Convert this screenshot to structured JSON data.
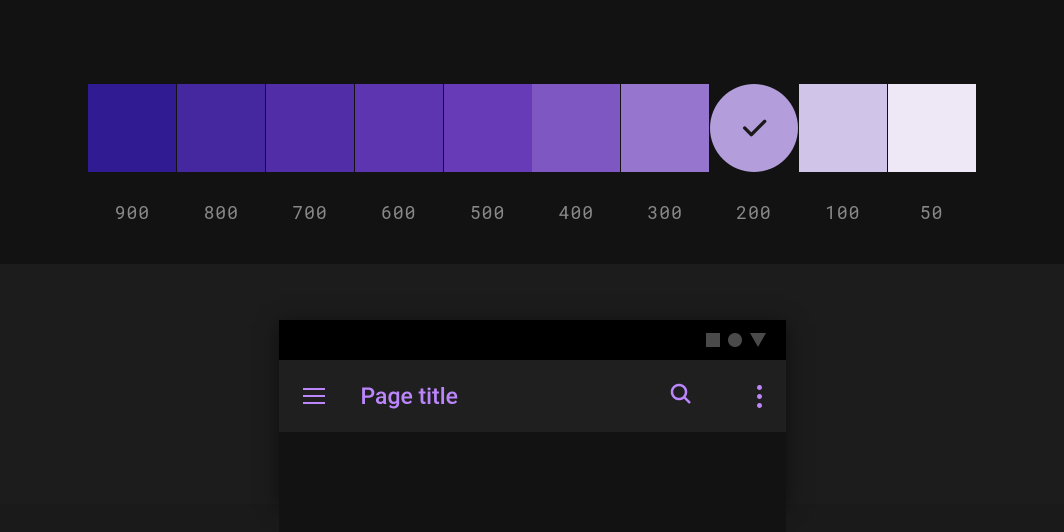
{
  "palette": {
    "swatches": [
      {
        "label": "900",
        "color": "#311B92",
        "selected": false
      },
      {
        "label": "800",
        "color": "#4527A0",
        "selected": false
      },
      {
        "label": "700",
        "color": "#512DA8",
        "selected": false
      },
      {
        "label": "600",
        "color": "#5E35B1",
        "selected": false
      },
      {
        "label": "500",
        "color": "#673AB7",
        "selected": false
      },
      {
        "label": "400",
        "color": "#7E57C2",
        "selected": false
      },
      {
        "label": "300",
        "color": "#9575CD",
        "selected": false
      },
      {
        "label": "200",
        "color": "#B39DDB",
        "selected": true
      },
      {
        "label": "100",
        "color": "#D1C4E9",
        "selected": false
      },
      {
        "label": "50",
        "color": "#EDE7F6",
        "selected": false
      }
    ],
    "selected_check_stroke": "#1a1a1a"
  },
  "preview": {
    "app_bar": {
      "title": "Page title",
      "accent_color": "#bb86fc"
    }
  }
}
